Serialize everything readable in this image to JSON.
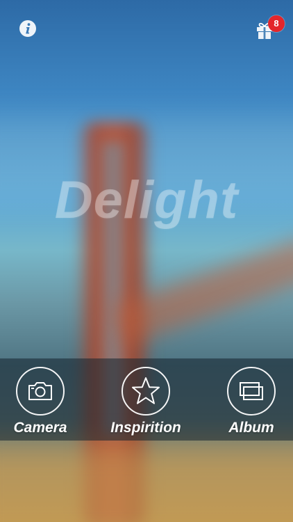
{
  "app": {
    "logo_text": "Delight"
  },
  "header": {
    "gift_badge_count": "8",
    "badge_color": "#e3262b"
  },
  "toolbar": {
    "items": [
      {
        "label": "Camera",
        "icon": "camera-icon"
      },
      {
        "label": "Inspirition",
        "icon": "star-icon"
      },
      {
        "label": "Album",
        "icon": "album-icon"
      }
    ]
  }
}
